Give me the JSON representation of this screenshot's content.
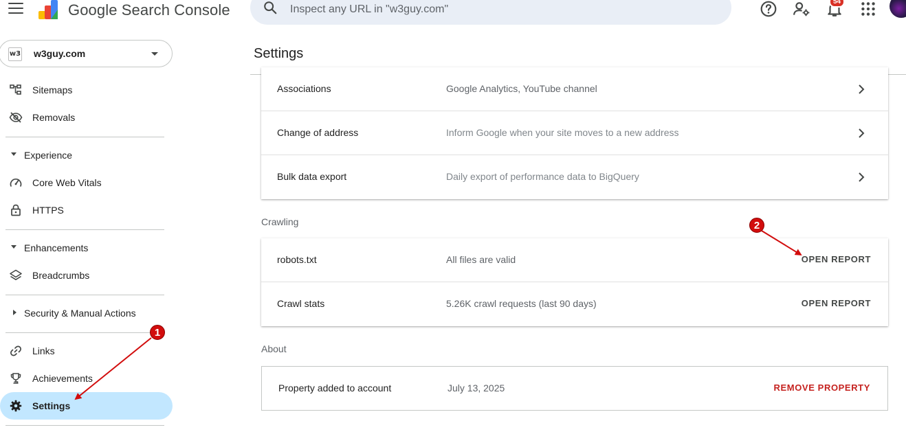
{
  "app": {
    "product_name": "Google Search Console"
  },
  "search": {
    "placeholder": "Inspect any URL in \"w3guy.com\""
  },
  "header": {
    "notification_count": "54"
  },
  "property": {
    "icon_text": "w3",
    "name": "w3guy.com"
  },
  "sidebar": {
    "items_top": [
      {
        "label": "Sitemaps",
        "icon": "sitemap-icon"
      },
      {
        "label": "Removals",
        "icon": "visibility-off-icon"
      }
    ],
    "experience": {
      "label": "Experience",
      "items": [
        {
          "label": "Core Web Vitals",
          "icon": "speed-gauge-icon"
        },
        {
          "label": "HTTPS",
          "icon": "lock-icon"
        }
      ]
    },
    "enhancements": {
      "label": "Enhancements",
      "items": [
        {
          "label": "Breadcrumbs",
          "icon": "layers-icon"
        }
      ]
    },
    "security": {
      "label": "Security & Manual Actions"
    },
    "items_bottom": [
      {
        "label": "Links",
        "icon": "link-icon"
      },
      {
        "label": "Achievements",
        "icon": "trophy-icon"
      },
      {
        "label": "Settings",
        "icon": "gear-icon",
        "active": true
      }
    ]
  },
  "main": {
    "title": "Settings",
    "general_rows": [
      {
        "label": "Associations",
        "value": "Google Analytics, YouTube channel"
      },
      {
        "label": "Change of address",
        "value": "Inform Google when your site moves to a new address"
      },
      {
        "label": "Bulk data export",
        "value": "Daily export of performance data to BigQuery"
      }
    ],
    "crawling": {
      "heading": "Crawling",
      "rows": [
        {
          "label": "robots.txt",
          "value": "All files are valid",
          "action": "OPEN REPORT"
        },
        {
          "label": "Crawl stats",
          "value": "5.26K crawl requests (last 90 days)",
          "action": "OPEN REPORT"
        }
      ]
    },
    "about": {
      "heading": "About",
      "rows": [
        {
          "label": "Property added to account",
          "value": "July 13, 2025",
          "action": "REMOVE PROPERTY"
        }
      ]
    }
  },
  "annotations": {
    "marker_1": "1",
    "marker_2": "2",
    "color": "#d20d0d"
  },
  "colors": {
    "active_nav": "#c2e7ff",
    "search_bg": "#e9eef6",
    "danger": "#c5221f"
  }
}
